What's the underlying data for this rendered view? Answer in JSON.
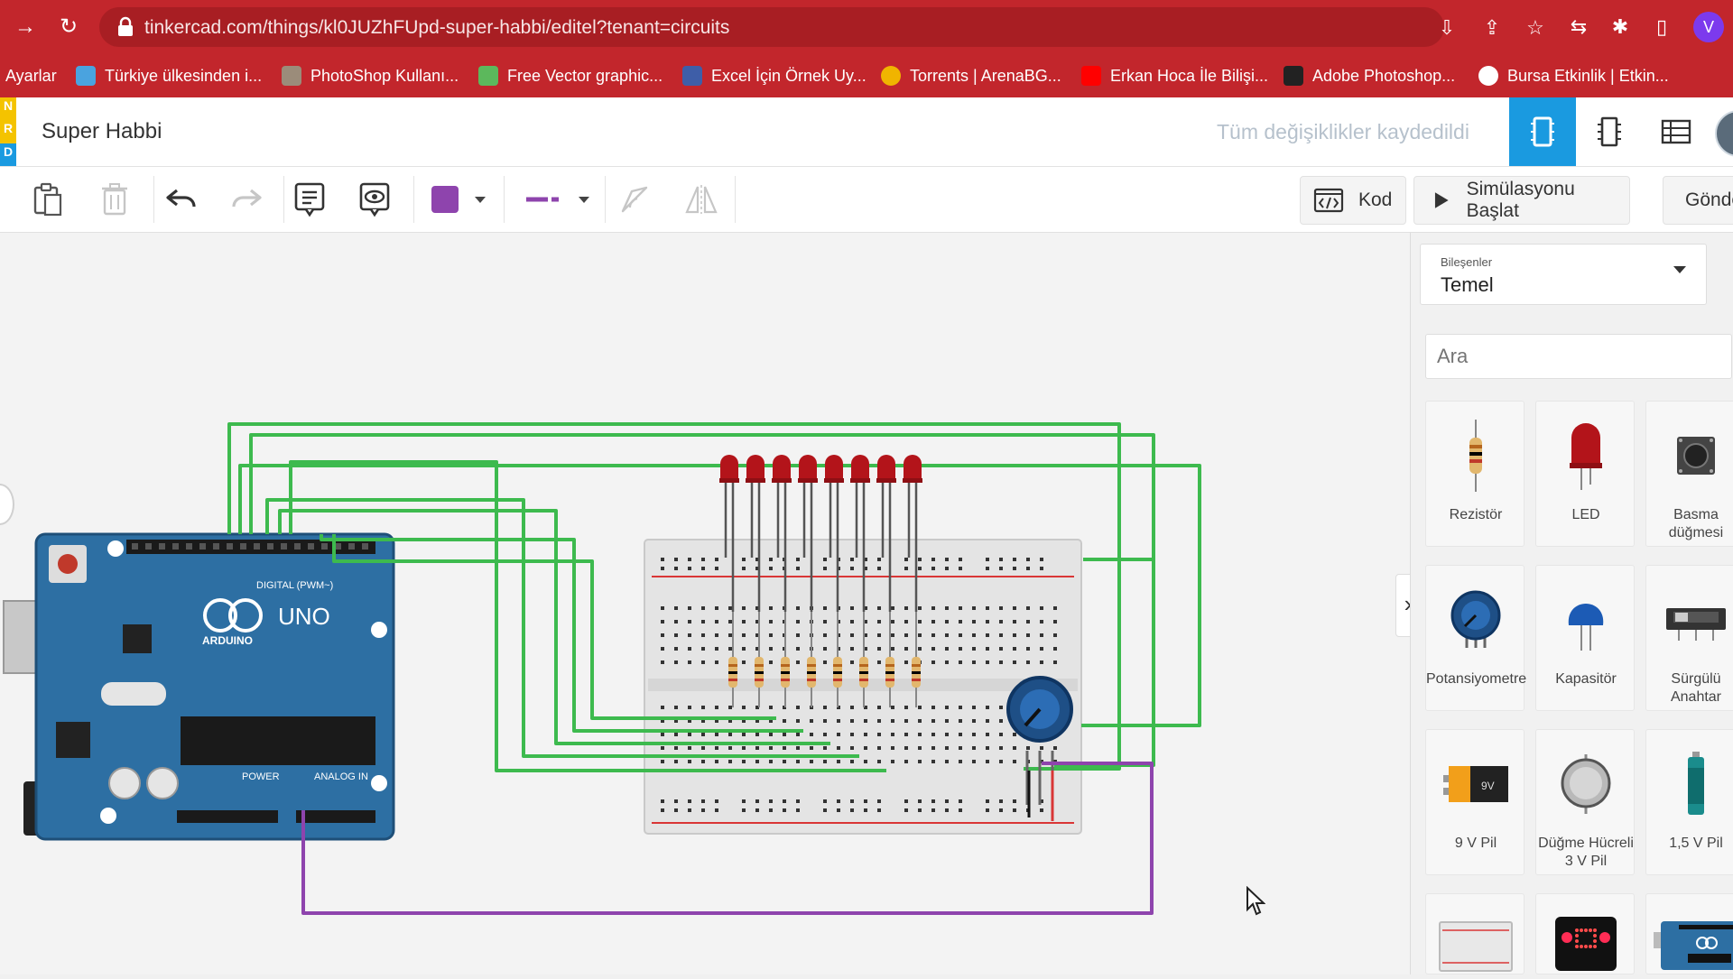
{
  "browser": {
    "url": "tinkercad.com/things/kl0JUZhFUpd-super-habbi/editel?tenant=circuits"
  },
  "bookmarks": [
    {
      "label": "Ayarlar",
      "color": "#c2262c"
    },
    {
      "label": "Türkiye ülkesinden i...",
      "color": "#4aa3df"
    },
    {
      "label": "PhotoShop Kullanı...",
      "color": "#9b8c7a"
    },
    {
      "label": "Free Vector graphic...",
      "color": "#5cb85c"
    },
    {
      "label": "Excel İçin Örnek Uy...",
      "color": "#3e5ea8"
    },
    {
      "label": "Torrents | ArenaBG...",
      "color": "#f0b400"
    },
    {
      "label": "Erkan Hoca İle Bilişi...",
      "color": "#ff0000"
    },
    {
      "label": "Adobe Photoshop...",
      "color": "#222222"
    },
    {
      "label": "Bursa Etkinlik | Etkin...",
      "color": "#ffffff"
    }
  ],
  "app": {
    "logo_letters": [
      "N",
      "R",
      "D"
    ],
    "logo_colors": [
      "#f4c300",
      "#f4c300",
      "#1a9ae0"
    ],
    "project_title": "Super Habbi",
    "save_status": "Tüm değişiklikler kaydedildi",
    "accent": "#1a9ae0"
  },
  "toolbar": {
    "code_label": "Kod",
    "simulate_label": "Simülasyonu Başlat",
    "send_label": "Gönde",
    "fill_color": "#8e44ad"
  },
  "panel": {
    "category_label": "Bileşenler",
    "category_value": "Temel",
    "search_placeholder": "Ara",
    "components": [
      {
        "name": "Rezistör",
        "icon": "resistor-icon"
      },
      {
        "name": "LED",
        "icon": "led-icon"
      },
      {
        "name": "Basma düğmesi",
        "icon": "pushbutton-icon"
      },
      {
        "name": "Potansiyometre",
        "icon": "potentiometer-icon"
      },
      {
        "name": "Kapasitör",
        "icon": "capacitor-icon"
      },
      {
        "name": "Sürgülü Anahtar",
        "icon": "slide-switch-icon"
      },
      {
        "name": "9 V Pil",
        "icon": "battery-9v-icon"
      },
      {
        "name": "Düğme Hücreli 3 V Pil",
        "icon": "coin-cell-icon"
      },
      {
        "name": "1,5 V Pil",
        "icon": "battery-aa-icon"
      }
    ]
  },
  "arduino": {
    "brand": "ARDUINO",
    "model": "UNO",
    "digital_label": "DIGITAL (PWM~)",
    "power_label": "POWER",
    "analog_label": "ANALOG IN"
  },
  "circuit": {
    "led_count": 8,
    "wire_color": "#3dba4e",
    "wiper_wire_color": "#8e44ad"
  }
}
